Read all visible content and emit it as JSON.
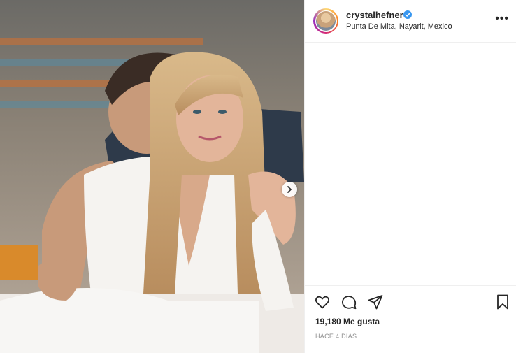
{
  "header": {
    "username": "crystalhefner",
    "location": "Punta De Mita, Nayarit, Mexico",
    "more_label": "•••"
  },
  "post": {
    "likes_label": "19,180 Me gusta",
    "time_label": "HACE 4 DÍAS"
  },
  "icons": {
    "like": "heart-icon",
    "comment": "comment-icon",
    "share": "send-icon",
    "save": "bookmark-icon",
    "next": "chevron-right-icon",
    "verified": "verified-badge-icon"
  },
  "colors": {
    "text": "#262626",
    "muted": "#8e8e8e",
    "verified": "#3897f0",
    "divider": "#efefef"
  }
}
